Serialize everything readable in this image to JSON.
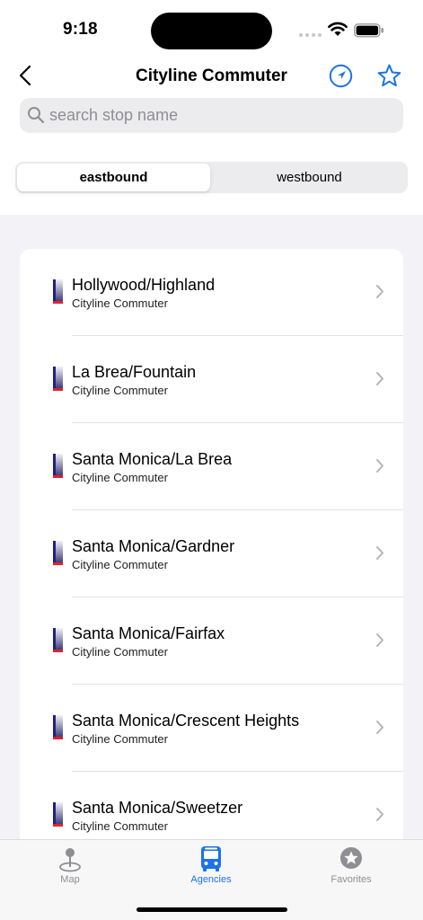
{
  "status_bar": {
    "time": "9:18"
  },
  "nav": {
    "title": "Cityline Commuter"
  },
  "search": {
    "placeholder": "search stop name"
  },
  "segments": {
    "eastbound": "eastbound",
    "westbound": "westbound"
  },
  "stops": [
    {
      "name": "Hollywood/Highland",
      "agency": "Cityline Commuter"
    },
    {
      "name": "La Brea/Fountain",
      "agency": "Cityline Commuter"
    },
    {
      "name": "Santa Monica/La Brea",
      "agency": "Cityline Commuter"
    },
    {
      "name": "Santa Monica/Gardner",
      "agency": "Cityline Commuter"
    },
    {
      "name": "Santa Monica/Fairfax",
      "agency": "Cityline Commuter"
    },
    {
      "name": "Santa Monica/Crescent Heights",
      "agency": "Cityline Commuter"
    },
    {
      "name": "Santa Monica/Sweetzer",
      "agency": "Cityline Commuter"
    }
  ],
  "tabs": {
    "map": "Map",
    "agencies": "Agencies",
    "favorites": "Favorites"
  },
  "colors": {
    "accent": "#1a73e8",
    "stop_marker_base": "#e5202d",
    "stop_marker_bar": "#1f1f8a"
  },
  "icons": [
    "back-chevron-icon",
    "location-arrow-icon",
    "star-icon",
    "search-icon",
    "chevron-right-icon",
    "map-pin-icon",
    "bus-icon",
    "star-circle-icon"
  ]
}
